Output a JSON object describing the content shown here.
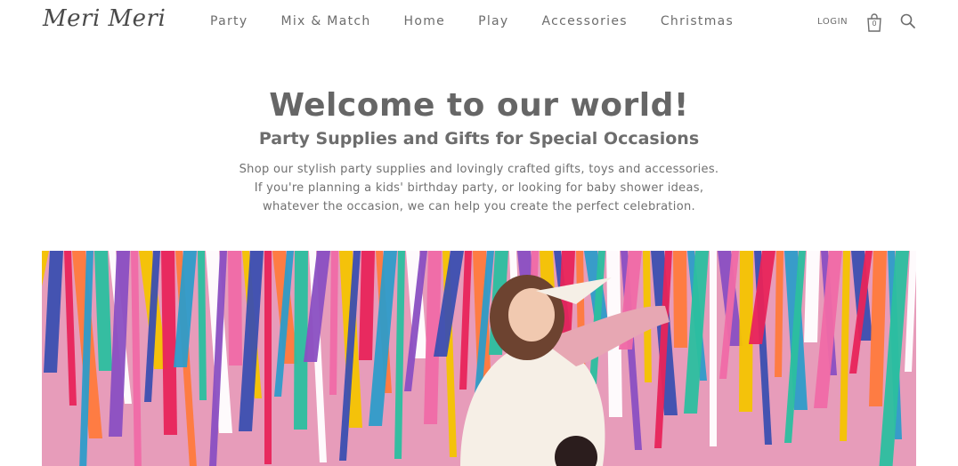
{
  "brand": {
    "logo_text": "Meri Meri"
  },
  "nav": {
    "items": [
      {
        "label": "Party"
      },
      {
        "label": "Mix & Match"
      },
      {
        "label": "Home"
      },
      {
        "label": "Play"
      },
      {
        "label": "Accessories"
      },
      {
        "label": "Christmas"
      }
    ]
  },
  "header": {
    "login_label": "LOGIN",
    "cart_count": "0"
  },
  "hero": {
    "title": "Welcome to our world!",
    "subtitle": "Party Supplies and Gifts for Special Occasions",
    "description": "Shop our stylish party supplies and lovingly crafted gifts, toys and accessories. If you're planning a kids' birthday party, or looking for baby shower ideas, whatever the occasion, we can help you create the perfect celebration."
  },
  "icons": [
    "shopping-bag-icon",
    "search-icon"
  ],
  "colors": {
    "text": "#6b6b6b",
    "banner_background": "#e79cba",
    "streamer_palette": [
      "#f4c400",
      "#e8245a",
      "#2e9cc9",
      "#ffffff",
      "#f06aa6",
      "#3b4fb0",
      "#ff7a3c",
      "#2bbf9f",
      "#8a4fc2"
    ]
  }
}
